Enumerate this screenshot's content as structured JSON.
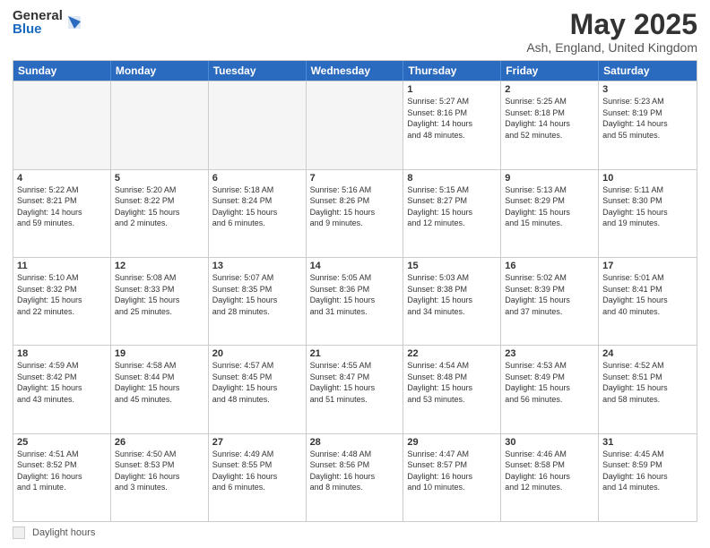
{
  "logo": {
    "general": "General",
    "blue": "Blue"
  },
  "title": "May 2025",
  "location": "Ash, England, United Kingdom",
  "days_of_week": [
    "Sunday",
    "Monday",
    "Tuesday",
    "Wednesday",
    "Thursday",
    "Friday",
    "Saturday"
  ],
  "footer": {
    "legend_label": "Daylight hours"
  },
  "weeks": [
    [
      {
        "day": "",
        "empty": true,
        "info": ""
      },
      {
        "day": "",
        "empty": true,
        "info": ""
      },
      {
        "day": "",
        "empty": true,
        "info": ""
      },
      {
        "day": "",
        "empty": true,
        "info": ""
      },
      {
        "day": "1",
        "empty": false,
        "info": "Sunrise: 5:27 AM\nSunset: 8:16 PM\nDaylight: 14 hours\nand 48 minutes."
      },
      {
        "day": "2",
        "empty": false,
        "info": "Sunrise: 5:25 AM\nSunset: 8:18 PM\nDaylight: 14 hours\nand 52 minutes."
      },
      {
        "day": "3",
        "empty": false,
        "info": "Sunrise: 5:23 AM\nSunset: 8:19 PM\nDaylight: 14 hours\nand 55 minutes."
      }
    ],
    [
      {
        "day": "4",
        "empty": false,
        "info": "Sunrise: 5:22 AM\nSunset: 8:21 PM\nDaylight: 14 hours\nand 59 minutes."
      },
      {
        "day": "5",
        "empty": false,
        "info": "Sunrise: 5:20 AM\nSunset: 8:22 PM\nDaylight: 15 hours\nand 2 minutes."
      },
      {
        "day": "6",
        "empty": false,
        "info": "Sunrise: 5:18 AM\nSunset: 8:24 PM\nDaylight: 15 hours\nand 6 minutes."
      },
      {
        "day": "7",
        "empty": false,
        "info": "Sunrise: 5:16 AM\nSunset: 8:26 PM\nDaylight: 15 hours\nand 9 minutes."
      },
      {
        "day": "8",
        "empty": false,
        "info": "Sunrise: 5:15 AM\nSunset: 8:27 PM\nDaylight: 15 hours\nand 12 minutes."
      },
      {
        "day": "9",
        "empty": false,
        "info": "Sunrise: 5:13 AM\nSunset: 8:29 PM\nDaylight: 15 hours\nand 15 minutes."
      },
      {
        "day": "10",
        "empty": false,
        "info": "Sunrise: 5:11 AM\nSunset: 8:30 PM\nDaylight: 15 hours\nand 19 minutes."
      }
    ],
    [
      {
        "day": "11",
        "empty": false,
        "info": "Sunrise: 5:10 AM\nSunset: 8:32 PM\nDaylight: 15 hours\nand 22 minutes."
      },
      {
        "day": "12",
        "empty": false,
        "info": "Sunrise: 5:08 AM\nSunset: 8:33 PM\nDaylight: 15 hours\nand 25 minutes."
      },
      {
        "day": "13",
        "empty": false,
        "info": "Sunrise: 5:07 AM\nSunset: 8:35 PM\nDaylight: 15 hours\nand 28 minutes."
      },
      {
        "day": "14",
        "empty": false,
        "info": "Sunrise: 5:05 AM\nSunset: 8:36 PM\nDaylight: 15 hours\nand 31 minutes."
      },
      {
        "day": "15",
        "empty": false,
        "info": "Sunrise: 5:03 AM\nSunset: 8:38 PM\nDaylight: 15 hours\nand 34 minutes."
      },
      {
        "day": "16",
        "empty": false,
        "info": "Sunrise: 5:02 AM\nSunset: 8:39 PM\nDaylight: 15 hours\nand 37 minutes."
      },
      {
        "day": "17",
        "empty": false,
        "info": "Sunrise: 5:01 AM\nSunset: 8:41 PM\nDaylight: 15 hours\nand 40 minutes."
      }
    ],
    [
      {
        "day": "18",
        "empty": false,
        "info": "Sunrise: 4:59 AM\nSunset: 8:42 PM\nDaylight: 15 hours\nand 43 minutes."
      },
      {
        "day": "19",
        "empty": false,
        "info": "Sunrise: 4:58 AM\nSunset: 8:44 PM\nDaylight: 15 hours\nand 45 minutes."
      },
      {
        "day": "20",
        "empty": false,
        "info": "Sunrise: 4:57 AM\nSunset: 8:45 PM\nDaylight: 15 hours\nand 48 minutes."
      },
      {
        "day": "21",
        "empty": false,
        "info": "Sunrise: 4:55 AM\nSunset: 8:47 PM\nDaylight: 15 hours\nand 51 minutes."
      },
      {
        "day": "22",
        "empty": false,
        "info": "Sunrise: 4:54 AM\nSunset: 8:48 PM\nDaylight: 15 hours\nand 53 minutes."
      },
      {
        "day": "23",
        "empty": false,
        "info": "Sunrise: 4:53 AM\nSunset: 8:49 PM\nDaylight: 15 hours\nand 56 minutes."
      },
      {
        "day": "24",
        "empty": false,
        "info": "Sunrise: 4:52 AM\nSunset: 8:51 PM\nDaylight: 15 hours\nand 58 minutes."
      }
    ],
    [
      {
        "day": "25",
        "empty": false,
        "info": "Sunrise: 4:51 AM\nSunset: 8:52 PM\nDaylight: 16 hours\nand 1 minute."
      },
      {
        "day": "26",
        "empty": false,
        "info": "Sunrise: 4:50 AM\nSunset: 8:53 PM\nDaylight: 16 hours\nand 3 minutes."
      },
      {
        "day": "27",
        "empty": false,
        "info": "Sunrise: 4:49 AM\nSunset: 8:55 PM\nDaylight: 16 hours\nand 6 minutes."
      },
      {
        "day": "28",
        "empty": false,
        "info": "Sunrise: 4:48 AM\nSunset: 8:56 PM\nDaylight: 16 hours\nand 8 minutes."
      },
      {
        "day": "29",
        "empty": false,
        "info": "Sunrise: 4:47 AM\nSunset: 8:57 PM\nDaylight: 16 hours\nand 10 minutes."
      },
      {
        "day": "30",
        "empty": false,
        "info": "Sunrise: 4:46 AM\nSunset: 8:58 PM\nDaylight: 16 hours\nand 12 minutes."
      },
      {
        "day": "31",
        "empty": false,
        "info": "Sunrise: 4:45 AM\nSunset: 8:59 PM\nDaylight: 16 hours\nand 14 minutes."
      }
    ]
  ]
}
